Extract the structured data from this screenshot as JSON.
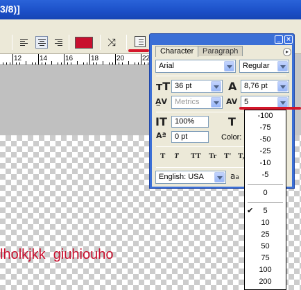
{
  "window": {
    "title": "3/8)]"
  },
  "canvas": {
    "text": "lholkjkk  giuhiouho",
    "text_color": "#c8102e"
  },
  "ruler": {
    "labels": [
      "12",
      "14",
      "16",
      "18",
      "20",
      "22"
    ]
  },
  "options_bar": {
    "text_color_swatch": "#c8102e"
  },
  "character_panel": {
    "tabs": [
      {
        "label": "Character",
        "active": true
      },
      {
        "label": "Paragraph",
        "active": false
      }
    ],
    "font_family": "Arial",
    "font_style": "Regular",
    "font_size": "36 pt",
    "leading": "8,76 pt",
    "kerning": "Metrics",
    "tracking": "5",
    "vertical_scale": "100%",
    "baseline_shift": "0 pt",
    "color_label": "Color:",
    "language": "English: USA",
    "antialias_icon_text": "a",
    "type_style_buttons": [
      "T",
      "T",
      "TT",
      "Tr",
      "T'",
      "T,"
    ]
  },
  "tracking_dropdown": {
    "groups": [
      [
        "-100",
        "-75",
        "-50",
        "-25",
        "-10",
        "-5"
      ],
      [
        "0"
      ],
      [
        "5",
        "10",
        "25",
        "50",
        "75",
        "100",
        "200"
      ]
    ],
    "selected": "5"
  }
}
